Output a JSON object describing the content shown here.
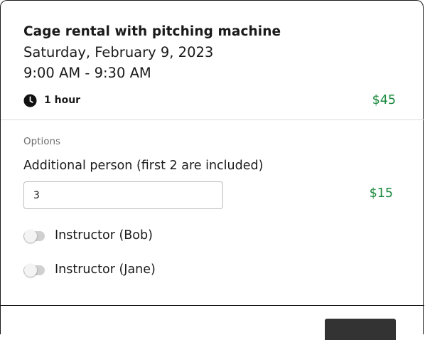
{
  "booking": {
    "title": "Cage rental with pitching machine",
    "date": "Saturday, February 9, 2023",
    "time": "9:00 AM - 9:30 AM",
    "duration": "1 hour",
    "duration_icon": "clock-icon",
    "price": "$45"
  },
  "options": {
    "heading": "Options",
    "additional_person": {
      "label": "Additional person (first 2 are included)",
      "value": "3",
      "price": "$15"
    },
    "toggles": [
      {
        "label": "Instructor (Bob)",
        "on": false
      },
      {
        "label": "Instructor (Jane)",
        "on": false
      }
    ]
  },
  "colors": {
    "price": "#1c8a3e",
    "toggle_off": "#d0d0d0",
    "footer_button": "#333333"
  }
}
